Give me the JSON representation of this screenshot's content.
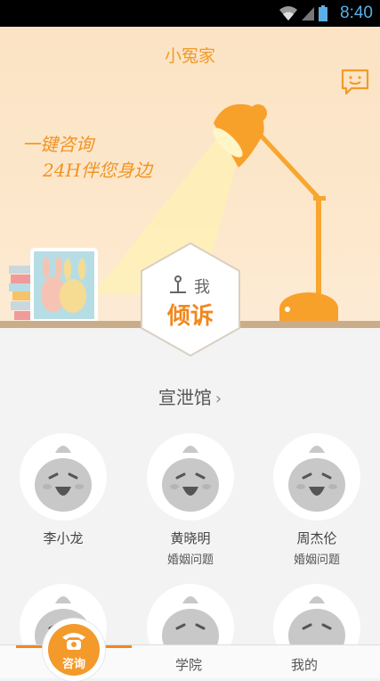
{
  "status_bar": {
    "time": "8:40"
  },
  "header": {
    "title": "小冤家"
  },
  "banner": {
    "slogan_line1": "一键咨询",
    "slogan_line2": "24H伴您身边"
  },
  "confide_button": {
    "top_text": "我",
    "main_text": "倾诉"
  },
  "section": {
    "title": "宣泄馆",
    "chevron": "›"
  },
  "counselors": [
    {
      "name": "李小龙",
      "topic": ""
    },
    {
      "name": "黄晓明",
      "topic": "婚姻问题"
    },
    {
      "name": "周杰伦",
      "topic": "婚姻问题"
    }
  ],
  "tabs": [
    {
      "label": "咨询"
    },
    {
      "label": "学院"
    },
    {
      "label": "我的"
    }
  ],
  "colors": {
    "accent": "#f0881d",
    "title_orange": "#f09b2a",
    "hero_bg": "#fbe3c4",
    "status_blue": "#5ab0e6"
  }
}
